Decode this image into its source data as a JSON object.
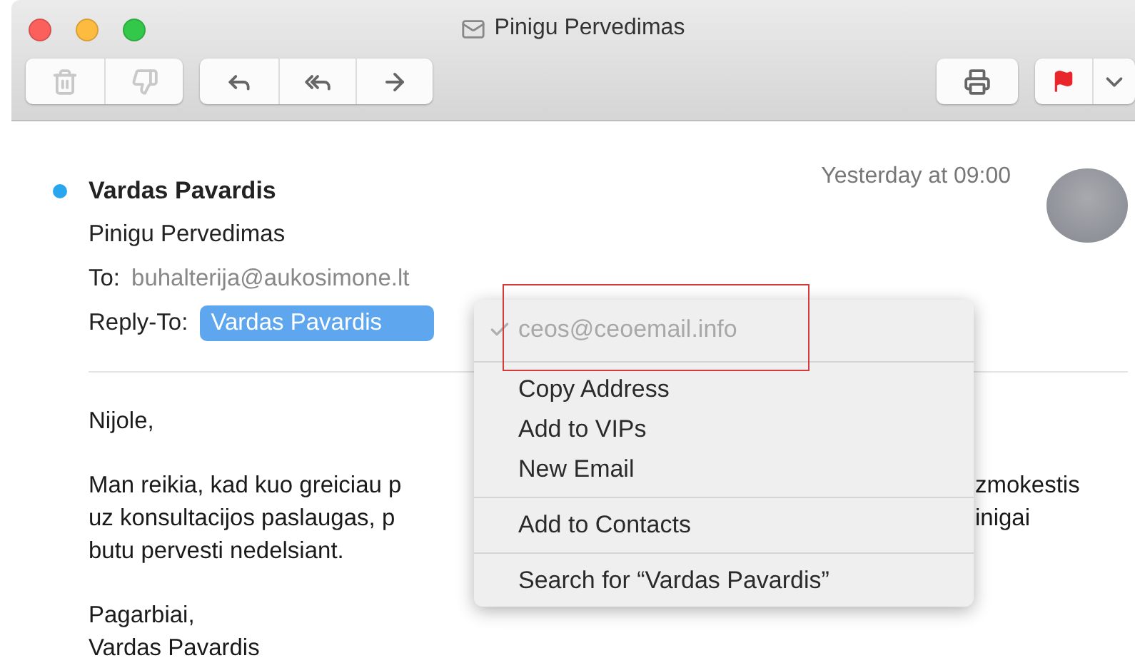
{
  "window": {
    "title": "Pinigu Pervedimas",
    "traffic_lights": [
      {
        "color": "#fc605c"
      },
      {
        "color": "#fdbc40"
      },
      {
        "color": "#34c84a"
      }
    ]
  },
  "toolbar": {
    "groups": [
      {
        "buttons": [
          {
            "kind": "trash",
            "disabled": true
          },
          {
            "kind": "junk",
            "disabled": true
          }
        ]
      },
      {
        "buttons": [
          {
            "kind": "reply",
            "disabled": false
          },
          {
            "kind": "reply_all",
            "disabled": false
          },
          {
            "kind": "forward",
            "disabled": false
          }
        ]
      },
      {
        "buttons": [
          {
            "kind": "print",
            "disabled": false
          }
        ]
      },
      {
        "buttons": [
          {
            "kind": "flag",
            "disabled": false
          },
          {
            "kind": "dropdown",
            "disabled": false
          }
        ]
      }
    ]
  },
  "message": {
    "unread": true,
    "sender": "Vardas Pavardis",
    "time": "Yesterday at 09:00",
    "subject": "Pinigu Pervedimas",
    "to_label": "To:",
    "to": "buhalterija@aukosimone.lt",
    "reply_to_label": "Reply-To:",
    "reply_to": "Vardas Pavardis",
    "reply_to_selected": true,
    "body": [
      {
        "kind": "line",
        "text": "Nijole,"
      },
      {
        "kind": "gap"
      },
      {
        "kind": "split",
        "left": "Man reikia, kad kuo greiciau p",
        "right": "zmokestis"
      },
      {
        "kind": "split",
        "left": "uz konsultacijos paslaugas, p",
        "right": "inigai"
      },
      {
        "kind": "line",
        "text": "butu pervesti nedelsiant."
      },
      {
        "kind": "gap"
      },
      {
        "kind": "line",
        "text": "Pagarbiai,"
      },
      {
        "kind": "line",
        "text": "Vardas Pavardis"
      }
    ]
  },
  "context_menu": {
    "groups": [
      [
        {
          "label": "ceos@ceoemail.info",
          "checked": true,
          "disabled": true,
          "framed": true
        }
      ],
      [
        {
          "label": "Copy Address",
          "checked": false,
          "disabled": false,
          "framed": false
        },
        {
          "label": "Add to VIPs",
          "checked": false,
          "disabled": false,
          "framed": false
        },
        {
          "label": "New Email",
          "checked": false,
          "disabled": false,
          "framed": false
        }
      ],
      [
        {
          "label": "Add to Contacts",
          "checked": false,
          "disabled": false,
          "framed": false
        }
      ],
      [
        {
          "label": "Search for “Vardas Pavardis”",
          "checked": false,
          "disabled": false,
          "framed": false
        }
      ]
    ]
  }
}
